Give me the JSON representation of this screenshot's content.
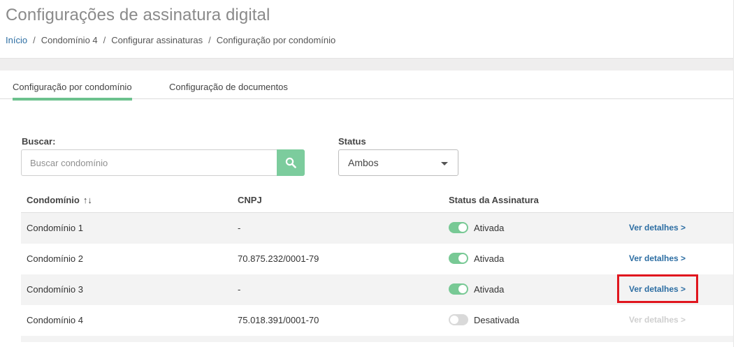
{
  "header": {
    "title": "Configurações de assinatura digital",
    "breadcrumb": [
      "Início",
      "Condomínio 4",
      "Configurar assinaturas",
      "Configuração por condomínio"
    ]
  },
  "tabs": [
    {
      "label": "Configuração por condomínio",
      "active": true
    },
    {
      "label": "Configuração de documentos",
      "active": false
    }
  ],
  "filters": {
    "search_label": "Buscar:",
    "search_placeholder": "Buscar condomínio",
    "search_value": "",
    "status_label": "Status",
    "status_selected": "Ambos"
  },
  "table": {
    "columns": [
      "Condomínio",
      "CNPJ",
      "Status da Assinatura",
      ""
    ],
    "rows": [
      {
        "name": "Condomínio 1",
        "cnpj": "-",
        "status": "Ativada",
        "enabled": true,
        "link": "Ver detalhes >"
      },
      {
        "name": "Condomínio 2",
        "cnpj": "70.875.232/0001-79",
        "status": "Ativada",
        "enabled": true,
        "link": "Ver detalhes >"
      },
      {
        "name": "Condomínio 3",
        "cnpj": "-",
        "status": "Ativada",
        "enabled": true,
        "link": "Ver detalhes >"
      },
      {
        "name": "Condomínio 4",
        "cnpj": "75.018.391/0001-70",
        "status": "Desativada",
        "enabled": false,
        "link": "Ver detalhes >"
      }
    ]
  },
  "colors": {
    "accent_green": "#7ccc9d",
    "link_blue": "#2d6ea3",
    "highlight_red": "#e0161e"
  },
  "icons": {
    "search": "search-icon",
    "sort": "sort-icon",
    "dropdown": "chevron-down-icon"
  }
}
